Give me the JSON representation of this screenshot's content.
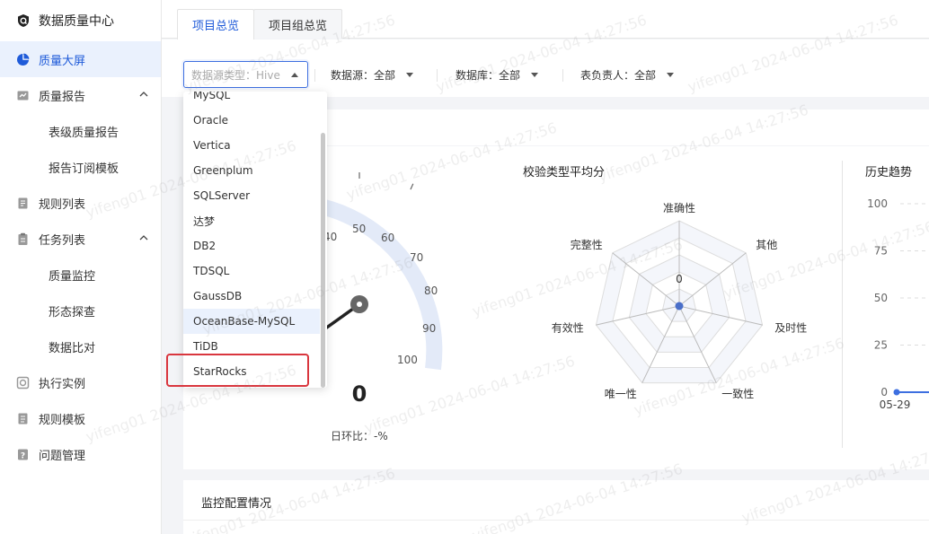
{
  "app": {
    "title": "数据质量中心"
  },
  "sidebar": {
    "items": [
      {
        "label": "质量大屏",
        "icon": "pie-chart-icon",
        "active": true
      },
      {
        "label": "质量报告",
        "icon": "report-icon",
        "expanded": true
      },
      {
        "label": "表级质量报告",
        "sub": true
      },
      {
        "label": "报告订阅模板",
        "sub": true
      },
      {
        "label": "规则列表",
        "icon": "list-icon"
      },
      {
        "label": "任务列表",
        "icon": "task-icon",
        "expanded": true
      },
      {
        "label": "质量监控",
        "sub": true
      },
      {
        "label": "形态探查",
        "sub": true
      },
      {
        "label": "数据比对",
        "sub": true
      },
      {
        "label": "执行实例",
        "icon": "instance-icon"
      },
      {
        "label": "规则模板",
        "icon": "template-icon"
      },
      {
        "label": "问题管理",
        "icon": "issue-icon"
      }
    ]
  },
  "tabs": [
    {
      "label": "项目总览",
      "active": true
    },
    {
      "label": "项目组总览",
      "active": false
    }
  ],
  "filters": {
    "datasource_type": "数据源类型：Hive",
    "datasource": "数据源：全部",
    "database": "数据库：全部",
    "owner": "表负责人：全部"
  },
  "dropdown": {
    "options": [
      "MySQL",
      "Oracle",
      "Vertica",
      "Greenplum",
      "SQLServer",
      "达梦",
      "DB2",
      "TDSQL",
      "GaussDB",
      "OceanBase-MySQL",
      "TiDB",
      "StarRocks"
    ],
    "hovered": "OceanBase-MySQL",
    "highlighted": "StarRocks"
  },
  "gauge": {
    "value": "0",
    "ticks": [
      "40",
      "50",
      "60",
      "70",
      "80",
      "90",
      "100"
    ],
    "daily_change": "日环比：-%"
  },
  "radar": {
    "title": "校验类型平均分",
    "axes": [
      "准确性",
      "其他",
      "及时性",
      "一致性",
      "唯一性",
      "有效性",
      "完整性"
    ],
    "center_label": "0",
    "values": [
      0,
      0,
      0,
      0,
      0,
      0,
      0
    ]
  },
  "trend": {
    "title": "历史趋势",
    "y_ticks": [
      "100",
      "75",
      "50",
      "25",
      "0"
    ],
    "x_first": "05-29"
  },
  "chart_data": [
    {
      "type": "radar",
      "title": "校验类型平均分",
      "categories": [
        "准确性",
        "其他",
        "及时性",
        "一致性",
        "唯一性",
        "有效性",
        "完整性"
      ],
      "values": [
        0,
        0,
        0,
        0,
        0,
        0,
        0
      ]
    },
    {
      "type": "line",
      "title": "历史趋势",
      "x": [
        "05-29"
      ],
      "values": [
        0
      ],
      "ylim": [
        0,
        100
      ],
      "y_ticks": [
        0,
        25,
        50,
        75,
        100
      ]
    }
  ],
  "monitor": {
    "title": "监控配置情况"
  },
  "watermark": {
    "text": "yifeng01 2024-06-04 14:27:56"
  },
  "colors": {
    "accent": "#1f5bd9",
    "highlight": "#d9363e",
    "gauge": "#e3eaf8"
  }
}
